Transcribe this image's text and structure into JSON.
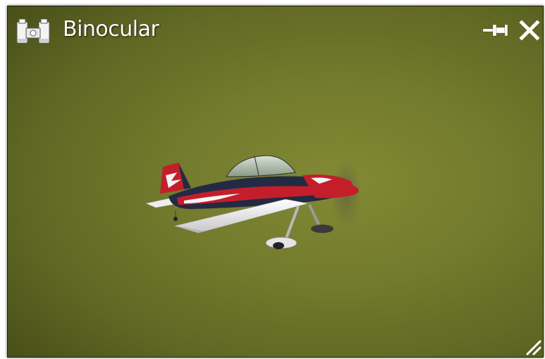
{
  "window": {
    "title": "Binocular",
    "icon": "binocular-icon",
    "controls": {
      "pin_icon": "pin-icon",
      "close_icon": "close-icon",
      "resize_icon": "resize-grip-icon"
    }
  },
  "view": {
    "subject": "aerobatic-airplane",
    "colors": {
      "background": "#727a2c",
      "plane_red": "#c41e2a",
      "plane_navy": "#232a44",
      "plane_white": "#f2f2f2"
    }
  }
}
